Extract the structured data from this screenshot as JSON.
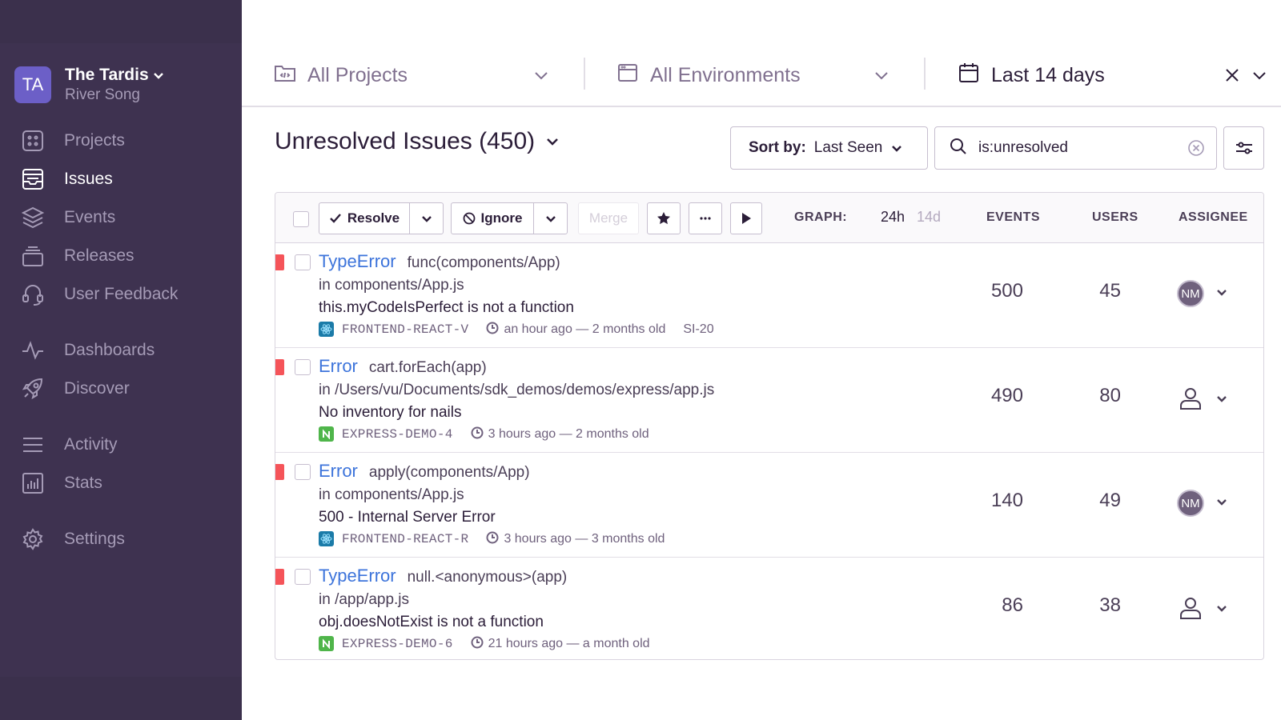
{
  "org": {
    "initials": "TA",
    "name": "The Tardis",
    "user": "River Song"
  },
  "nav": {
    "projects": "Projects",
    "issues": "Issues",
    "events": "Events",
    "releases": "Releases",
    "user_feedback": "User Feedback",
    "dashboards": "Dashboards",
    "discover": "Discover",
    "activity": "Activity",
    "stats": "Stats",
    "settings": "Settings"
  },
  "filters": {
    "projects": "All Projects",
    "environments": "All Environments",
    "time_range": "Last 14 days"
  },
  "header": {
    "title": "Unresolved Issues (450)",
    "sort_label": "Sort by:",
    "sort_value": "Last Seen",
    "search_value": "is:unresolved"
  },
  "toolbar": {
    "resolve": "Resolve",
    "ignore": "Ignore",
    "merge": "Merge",
    "graph_label": "GRAPH:",
    "graph_24h": "24h",
    "graph_14d": "14d",
    "col_events": "EVENTS",
    "col_users": "USERS",
    "col_assignee": "ASSIGNEE"
  },
  "issues": [
    {
      "type": "TypeError",
      "culprit": "func(components/App)",
      "location": "in components/App.js",
      "message": "this.myCodeIsPerfect is not a function",
      "project": "FRONTEND-REACT-V",
      "project_kind": "react",
      "time": "an hour ago — 2 months old",
      "short_id": "SI-20",
      "events": "500",
      "users": "45",
      "assignee": "NM"
    },
    {
      "type": "Error",
      "culprit": "cart.forEach(app)",
      "location": "in /Users/vu/Documents/sdk_demos/demos/express/app.js",
      "message": "No inventory for nails",
      "project": "EXPRESS-DEMO-4",
      "project_kind": "node",
      "time": "3 hours ago — 2 months old",
      "events": "490",
      "users": "80",
      "assignee": ""
    },
    {
      "type": "Error",
      "culprit": "apply(components/App)",
      "location": "in components/App.js",
      "message": "500 - Internal Server Error",
      "project": "FRONTEND-REACT-R",
      "project_kind": "react",
      "time": "3 hours ago — 3 months old",
      "events": "140",
      "users": "49",
      "assignee": "NM"
    },
    {
      "type": "TypeError",
      "culprit": "null.<anonymous>(app)",
      "location": "in /app/app.js",
      "message": "obj.doesNotExist is not a function",
      "project": "EXPRESS-DEMO-6",
      "project_kind": "node",
      "time": "21 hours ago — a month old",
      "events": "86",
      "users": "38",
      "assignee": ""
    }
  ],
  "colors": {
    "sidebar_bg": "#3e3250",
    "accent": "#6c5fc7",
    "link": "#3d74db",
    "error_level": "#f55459",
    "react": "#1b7ba8",
    "node": "#4fb54a"
  }
}
